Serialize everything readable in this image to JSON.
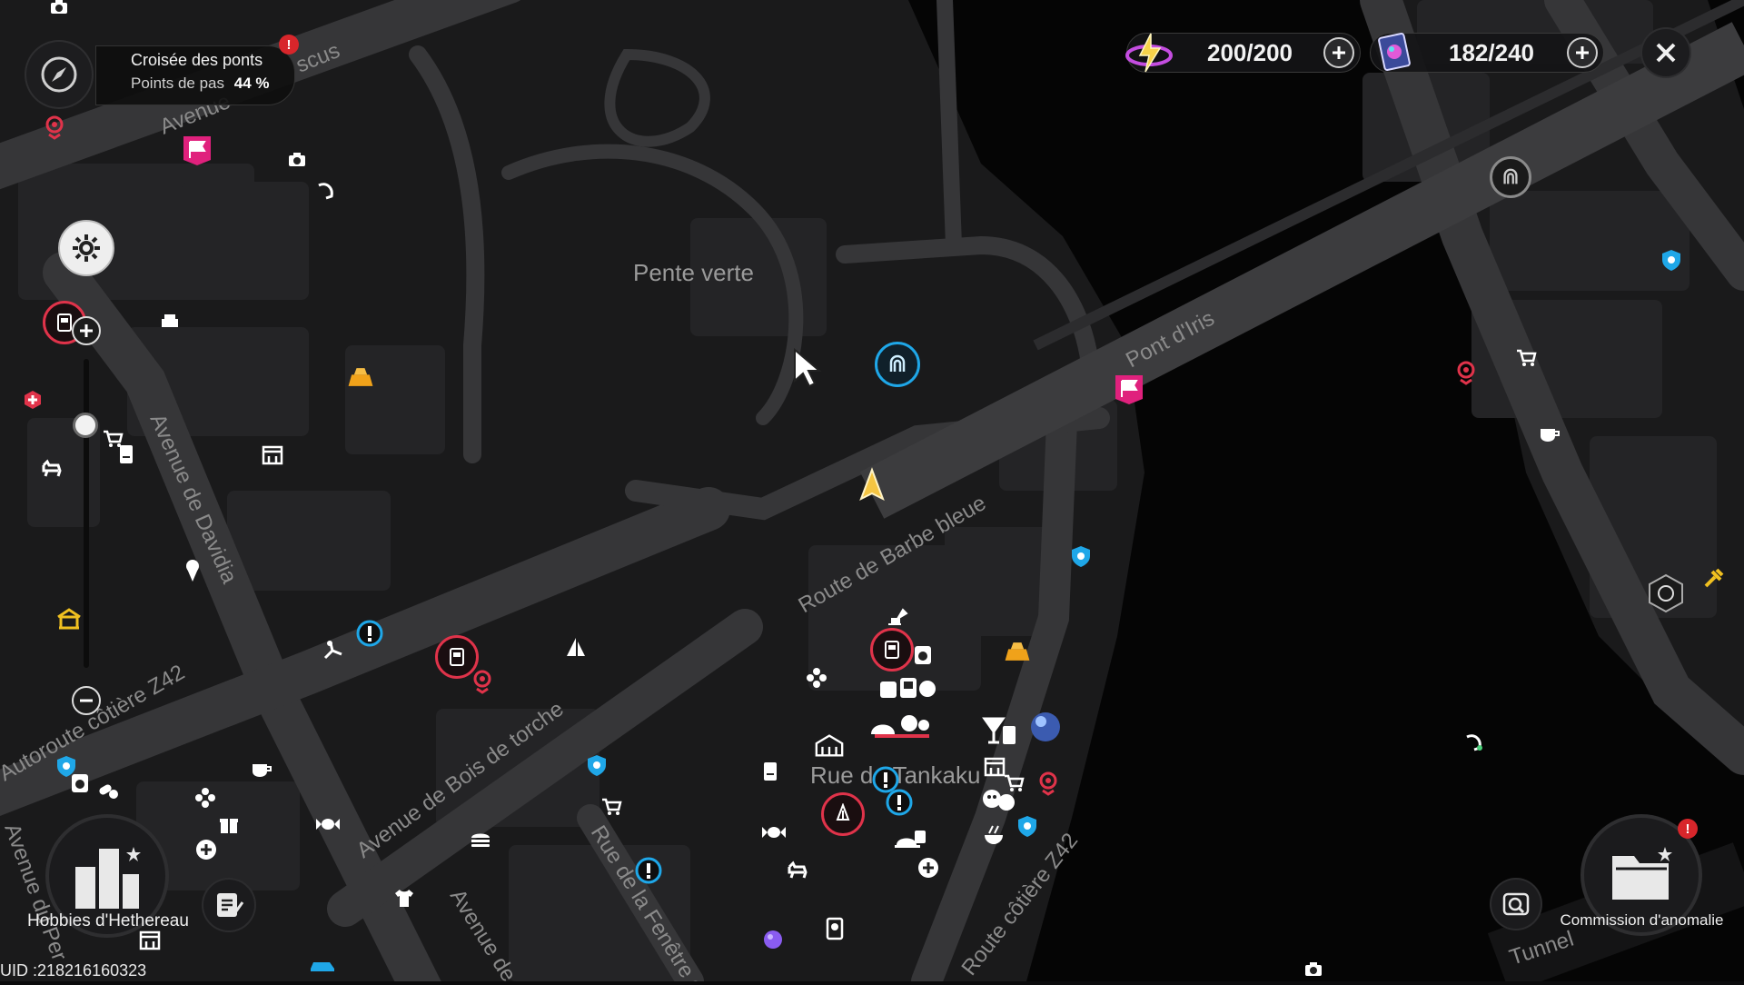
{
  "location": {
    "name": "Croisée des ponts",
    "progress_label": "Points de pas",
    "progress_value": "44 %"
  },
  "resources": [
    {
      "name": "stamina",
      "value": "200/200",
      "icon": "lightning-orb-icon"
    },
    {
      "name": "tickets",
      "value": "182/240",
      "icon": "holo-card-icon"
    }
  ],
  "labels": {
    "pente_verte": "Pente verte",
    "pont_iris": "Pont d'Iris",
    "route_barbe_bleue": "Route de Barbe bleue",
    "rue_tankaku": "Rue de Tankaku",
    "avenue_davidia": "Avenue de Davidia",
    "autoroute_z42": "Autoroute côtière Z42",
    "avenue_bois_torche": "Avenue de Bois de torche",
    "rue_fenetre": "Rue de la Fenêtre du",
    "route_cotiere_z42": "Route côtière Z42",
    "tunnel": "Tunnel",
    "avenue_top": "Avenue",
    "avenue_top_end": "scus",
    "avenue_bottom": "Avenue de",
    "avenue_left": "Avenue du Per"
  },
  "bottom": {
    "hobbies_label": "Hobbies d'Hethereau",
    "commission_label": "Commission d'anomalie",
    "uid": "UID :218216160323"
  },
  "colors": {
    "accent_blue": "#1fa7e8",
    "accent_pink": "#e0217d",
    "accent_red": "#e0334a",
    "accent_orange": "#f0a21a",
    "road": "#333335",
    "block": "#232325"
  }
}
